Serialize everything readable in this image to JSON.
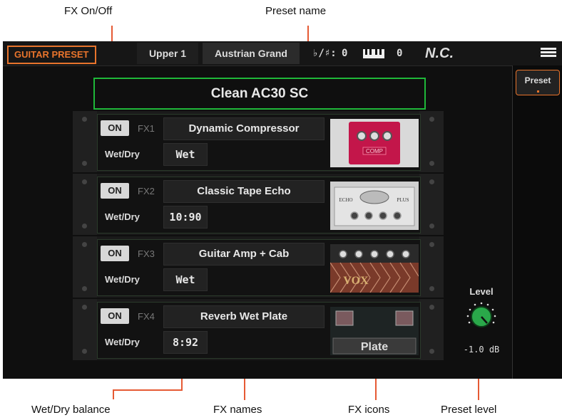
{
  "callouts": {
    "fx_onoff": "FX On/Off",
    "preset_name": "Preset name",
    "wet_dry_balance": "Wet/Dry balance",
    "fx_names": "FX names",
    "fx_icons": "FX icons",
    "preset_level": "Preset level"
  },
  "topbar": {
    "mode": "GUITAR PRESET",
    "part": "Upper 1",
    "sound": "Austrian Grand",
    "transpose_label": "♭/♯:",
    "transpose_value": "0",
    "octave_value": "0",
    "chord": "N.C."
  },
  "side": {
    "preset_label": "Preset"
  },
  "preset_name": "Clean AC30 SC",
  "fx": [
    {
      "on": "ON",
      "label": "FX1",
      "name": "Dynamic Compressor",
      "wd_label": "Wet/Dry",
      "wd_value": "Wet",
      "icon": "compressor-pedal-icon",
      "icon_text": "COMP"
    },
    {
      "on": "ON",
      "label": "FX2",
      "name": "Classic Tape Echo",
      "wd_label": "Wet/Dry",
      "wd_value": "10:90",
      "icon": "tape-echo-icon",
      "icon_text_left": "ECHO",
      "icon_text_right": "PLUS"
    },
    {
      "on": "ON",
      "label": "FX3",
      "name": "Guitar Amp + Cab",
      "wd_label": "Wet/Dry",
      "wd_value": "Wet",
      "icon": "amp-cab-icon",
      "icon_text": "VOX"
    },
    {
      "on": "ON",
      "label": "FX4",
      "name": "Reverb Wet Plate",
      "wd_label": "Wet/Dry",
      "wd_value": "8:92",
      "icon": "plate-reverb-icon",
      "icon_text": "Plate"
    }
  ],
  "level": {
    "label": "Level",
    "value": "-1.0 dB"
  },
  "colors": {
    "accent": "#e8742c",
    "green": "#1fb839",
    "callout_line": "#e65a34"
  }
}
